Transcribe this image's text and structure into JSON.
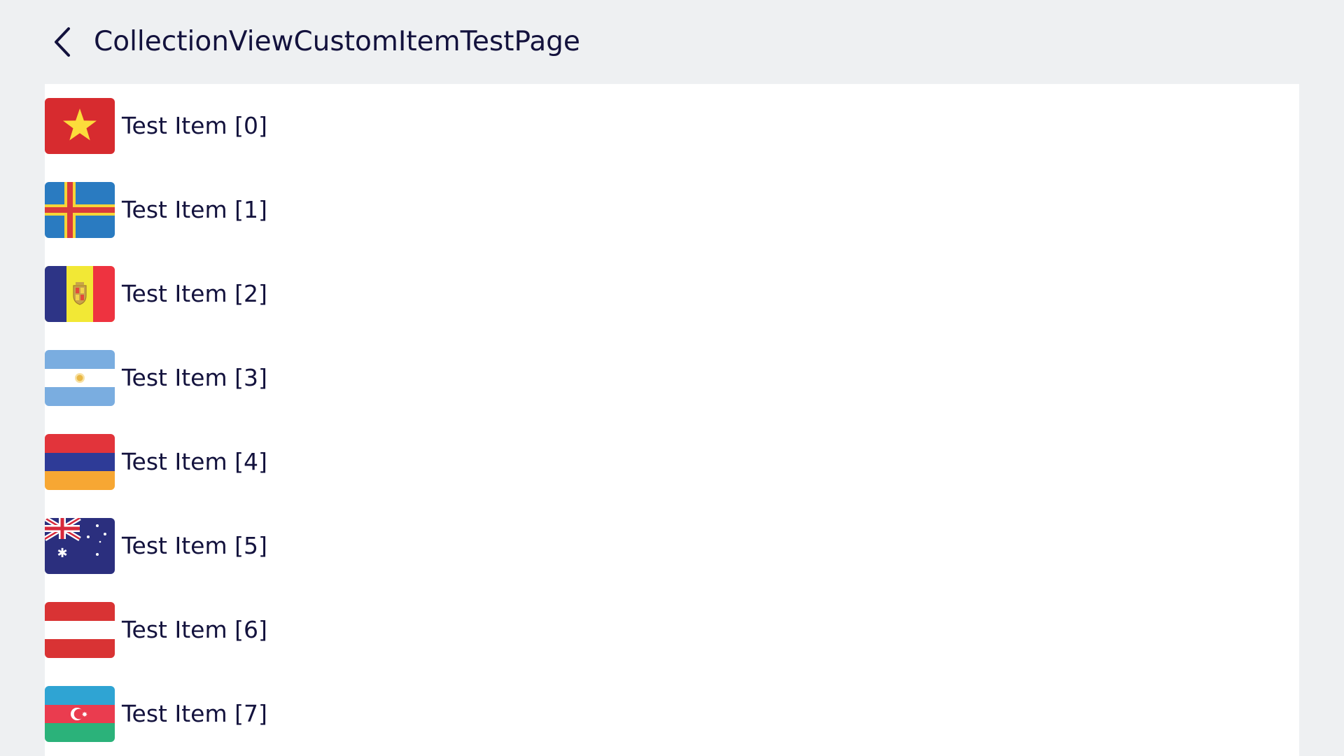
{
  "header": {
    "title": "CollectionViewCustomItemTestPage",
    "back_icon": "chevron-left-icon"
  },
  "list": {
    "items": [
      {
        "label": "Test Item [0]",
        "flag": "vietnam-flag-icon"
      },
      {
        "label": "Test Item [1]",
        "flag": "aland-flag-icon"
      },
      {
        "label": "Test Item [2]",
        "flag": "andorra-flag-icon"
      },
      {
        "label": "Test Item [3]",
        "flag": "argentina-flag-icon"
      },
      {
        "label": "Test Item [4]",
        "flag": "armenia-flag-icon"
      },
      {
        "label": "Test Item [5]",
        "flag": "australia-flag-icon"
      },
      {
        "label": "Test Item [6]",
        "flag": "austria-flag-icon"
      },
      {
        "label": "Test Item [7]",
        "flag": "azerbaijan-flag-icon"
      }
    ]
  },
  "colors": {
    "background": "#eef0f2",
    "list_background": "#ffffff",
    "text": "#13123d"
  }
}
